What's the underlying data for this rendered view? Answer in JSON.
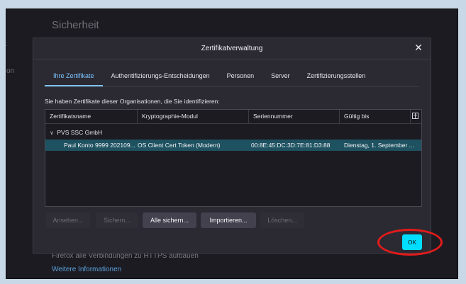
{
  "background": {
    "title": "Sicherheit",
    "side_label_1": "x",
    "side_label_2": "on",
    "https_text": "Firefox alle Verbindungen zu HTTPS aufbauen",
    "more_info_link": "Weitere Informationen"
  },
  "dialog": {
    "title": "Zertifikatverwaltung",
    "close_glyph": "✕",
    "tabs": [
      {
        "label": "Ihre Zertifikate",
        "active": true
      },
      {
        "label": "Authentifizierungs-Entscheidungen",
        "active": false
      },
      {
        "label": "Personen",
        "active": false
      },
      {
        "label": "Server",
        "active": false
      },
      {
        "label": "Zertifizierungsstellen",
        "active": false
      }
    ],
    "description": "Sie haben Zertifikate dieser Organisationen, die Sie identifizieren:",
    "table": {
      "columns": [
        "Zertifikatsname",
        "Kryptographie-Modul",
        "Seriennummer",
        "Gültig bis"
      ],
      "groups": [
        {
          "name": "PVS SSC GmbH",
          "expanded": true,
          "rows": [
            {
              "name": "Paul Konto 9999 202109...",
              "module": "OS Client Cert Token (Modern)",
              "serial": "00:8E:45:DC:3D:7E:81:D3:88",
              "valid_until": "Dienstag, 1. September ..."
            }
          ]
        }
      ]
    },
    "buttons": {
      "view": {
        "label": "Ansehen...",
        "enabled": false
      },
      "backup": {
        "label": "Sichern...",
        "enabled": false
      },
      "backup_all": {
        "label": "Alle sichern...",
        "enabled": true
      },
      "import": {
        "label": "Importieren...",
        "enabled": true
      },
      "delete": {
        "label": "Löschen...",
        "enabled": false
      }
    },
    "ok_label": "OK"
  },
  "colors": {
    "accent": "#00ddff",
    "active_tab": "#7cc4ff",
    "selected_row": "#1e5261",
    "annotation_ring": "#e31b1b"
  }
}
